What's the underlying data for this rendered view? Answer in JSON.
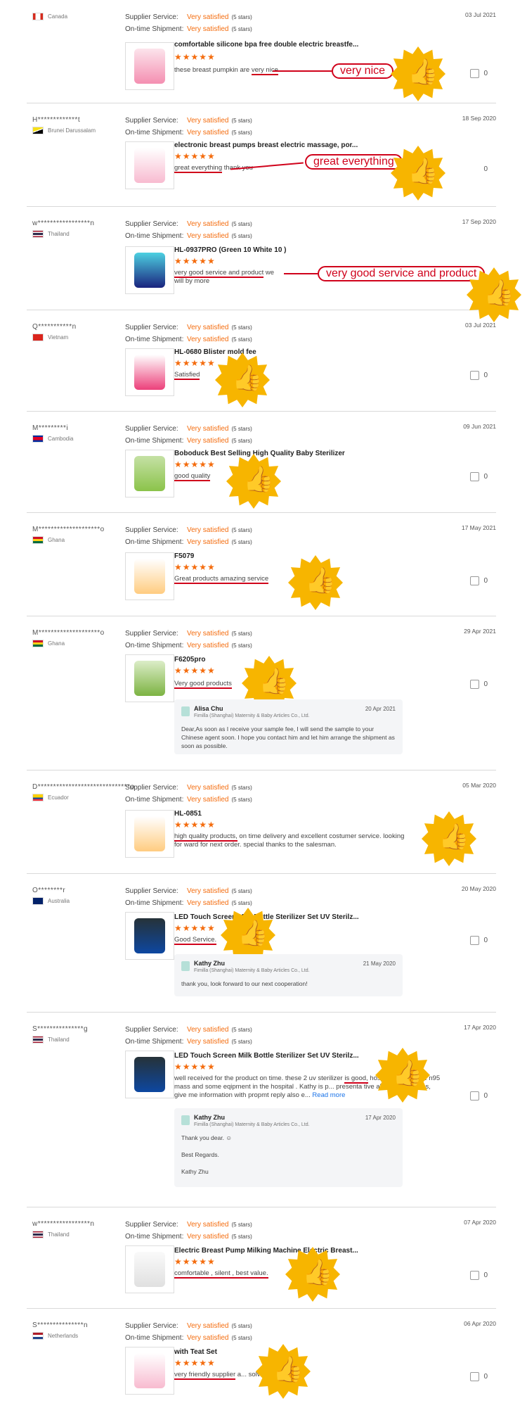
{
  "labels": {
    "supplier": "Supplier Service:",
    "shipment": "On-time Shipment:",
    "satisfied": "Very satisfied",
    "stars": "(5 stars)",
    "star_glyphs": "★★★★★",
    "read_more": "Read more"
  },
  "colors": {
    "accent": "#f46c0e",
    "callout": "#d0021b",
    "badge": "#f7b500"
  },
  "reviews": [
    {
      "buyer": "",
      "country": "Canada",
      "date": "03 Jul 2021",
      "title": "comfortable silicone bpa free double electric breastfe...",
      "text_pre": "these breast pumpkin are ",
      "text_u": "very nice",
      "text_post": "",
      "callout": "very nice",
      "likes": "0"
    },
    {
      "buyer": "H*************t",
      "country": "Brunei Darussalam",
      "date": "18 Sep 2020",
      "title": "electronic breast pumps breast electric massage, por...",
      "text_pre": "",
      "text_u": "great everything",
      "text_post": " thank you",
      "callout": "great everything",
      "likes": "0"
    },
    {
      "buyer": "w*****************n",
      "country": "Thailand",
      "date": "17 Sep 2020",
      "title": "HL-0937PRO (Green 10 White 10 )",
      "text_pre": "",
      "text_u": "very good service and product",
      "text_post": " we will by more",
      "callout": "very good service and product",
      "likes": ""
    },
    {
      "buyer": "Q***********n",
      "country": "Vietnam",
      "date": "03 Jul 2021",
      "title": "HL-0680 Blister mold fee",
      "text_pre": "",
      "text_u": "Satisfied",
      "text_post": "",
      "callout": "",
      "likes": "0"
    },
    {
      "buyer": "M*********i",
      "country": "Cambodia",
      "date": "09 Jun 2021",
      "title": "Boboduck Best Selling High Quality Baby Sterilizer",
      "text_pre": "",
      "text_u": "good quality",
      "text_post": "",
      "callout": "",
      "likes": "0"
    },
    {
      "buyer": "M********************o",
      "country": "Ghana",
      "date": "17 May 2021",
      "title": "F5079",
      "text_pre": "",
      "text_u": "Great products amazing service",
      "text_post": "",
      "callout": "",
      "likes": "0"
    },
    {
      "buyer": "M********************o",
      "country": "Ghana",
      "date": "29 Apr 2021",
      "title": "F6205pro",
      "text_pre": "",
      "text_u": "Very good products",
      "text_post": "",
      "callout": "",
      "likes": "0",
      "reply": {
        "name": "Alisa Chu",
        "company": "Fimilla (Shanghai) Maternity & Baby Articles Co., Ltd.",
        "date": "20 Apr 2021",
        "text": "Dear,As soon as I receive your sample fee, I will send the sample to your Chinese agent soon. I hope you contact him and let him arrange the shipment as soon as possible."
      }
    },
    {
      "buyer": "D******************************o",
      "country": "Ecuador",
      "date": "05 Mar 2020",
      "title": "HL-0851",
      "text_pre": "",
      "text_u": "high quality products,",
      "text_post": " on time delivery and excellent costumer service. looking for ward for next order. special thanks to the salesman.",
      "callout": "",
      "likes": ""
    },
    {
      "buyer": "O********r",
      "country": "Australia",
      "date": "20 May 2020",
      "title": "LED Touch Screen Milk Bottle Sterilizer Set UV Sterilz...",
      "text_pre": "",
      "text_u": "Good Service.",
      "text_post": "",
      "callout": "",
      "likes": "0",
      "reply": {
        "name": "Kathy Zhu",
        "company": "Fimilla (Shanghai) Maternity & Baby Articles Co., Ltd.",
        "date": "21 May 2020",
        "text": "thank you, look forward to our next cooperation!"
      }
    },
    {
      "buyer": "S***************g",
      "country": "Thailand",
      "date": "17 Apr 2020",
      "title": "LED Touch Screen Milk Bottle Sterilizer Set UV Sterilz...",
      "text_pre": "well received for the product on time. these 2 uv sterilizer ",
      "text_u": "is good,",
      "text_post": " hospital for sterilize n95 mass and some eqipment in the hospital . Kathy is p... presenta tive along the process, give me information with propmt reply also e...",
      "callout": "",
      "likes": "0",
      "reply": {
        "name": "Kathy Zhu",
        "company": "Fimilla (Shanghai) Maternity & Baby Articles Co., Ltd.",
        "date": "17 Apr 2020",
        "text": "Thank you dear. ☺\n\nBest Regards.\n\nKathy Zhu"
      }
    },
    {
      "buyer": "w*****************n",
      "country": "Thailand",
      "date": "07 Apr 2020",
      "title": "Electric Breast Pump Milking Machine Electric Breast...",
      "text_pre": "",
      "text_u": "comfortable , silent , best value.",
      "text_post": "",
      "callout": "",
      "likes": "0"
    },
    {
      "buyer": "S***************n",
      "country": "Netherlands",
      "date": "06 Apr 2020",
      "title": "with Teat Set",
      "text_pre": "",
      "text_u": "very friendly supplier",
      "text_post": " a... solve issues",
      "callout": "",
      "likes": "0"
    }
  ]
}
